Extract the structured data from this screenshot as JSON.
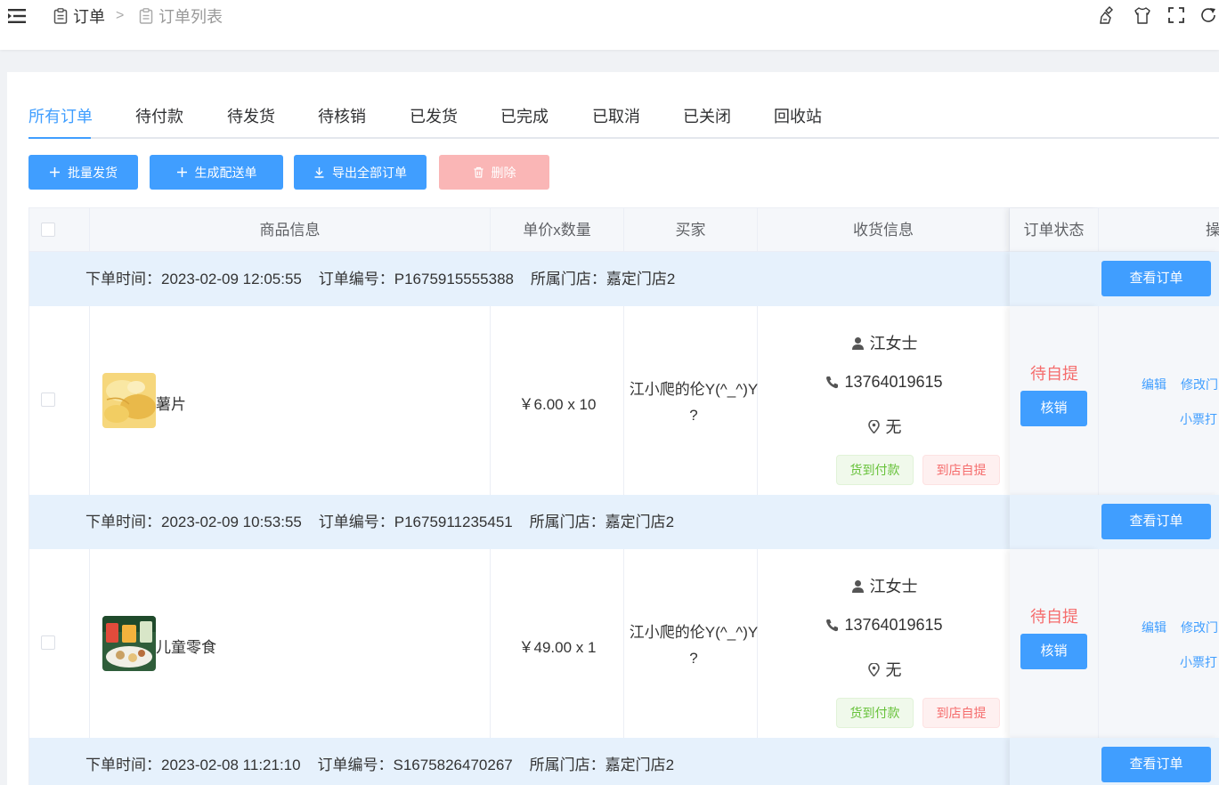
{
  "breadcrumb": {
    "level1": "订单",
    "separator": ">",
    "level2": "订单列表"
  },
  "header_tools": [
    "clear-icon",
    "theme-icon",
    "fullscreen-icon",
    "refresh-icon"
  ],
  "tabs": [
    "所有订单",
    "待付款",
    "待发货",
    "待核销",
    "已发货",
    "已完成",
    "已取消",
    "已关闭",
    "回收站"
  ],
  "active_tab": "所有订单",
  "toolbar": {
    "batch_ship": "批量发货",
    "gen_delivery": "生成配送单",
    "export_all": "导出全部订单",
    "delete": "删除"
  },
  "table": {
    "columns": [
      "商品信息",
      "单价x数量",
      "买家",
      "收货信息",
      "订单状态",
      "操"
    ]
  },
  "orders": [
    {
      "header": "下单时间：2023-02-09 12:05:55    订单编号：P1675915555388    所属门店：嘉定门店2",
      "view_button": "查看订单",
      "product_name": "薯片",
      "price_qty": "￥6.00 x 10",
      "buyer": "江小爬的伦Y(^_^)Y ?",
      "receiver_name": "江女士",
      "receiver_phone": "13764019615",
      "receiver_address": "无",
      "tag_payment": "货到付款",
      "tag_pickup": "到店自提",
      "status": "待自提",
      "verify_button": "核销",
      "op_edit": "编辑",
      "op_modify": "修改门",
      "op_print": "小票打"
    },
    {
      "header": "下单时间：2023-02-09 10:53:55    订单编号：P1675911235451    所属门店：嘉定门店2",
      "view_button": "查看订单",
      "product_name": "儿童零食",
      "price_qty": "￥49.00 x 1",
      "buyer": "江小爬的伦Y(^_^)Y ?",
      "receiver_name": "江女士",
      "receiver_phone": "13764019615",
      "receiver_address": "无",
      "tag_payment": "货到付款",
      "tag_pickup": "到店自提",
      "status": "待自提",
      "verify_button": "核销",
      "op_edit": "编辑",
      "op_modify": "修改门",
      "op_print": "小票打"
    },
    {
      "header": "下单时间：2023-02-08 11:21:10    订单编号：S1675826470267    所属门店：嘉定门店2",
      "view_button": "查看订单"
    }
  ],
  "colors": {
    "primary": "#409eff",
    "danger": "#f56c6c",
    "success": "#67c23a",
    "row_header_bg": "#e6f1fc"
  }
}
